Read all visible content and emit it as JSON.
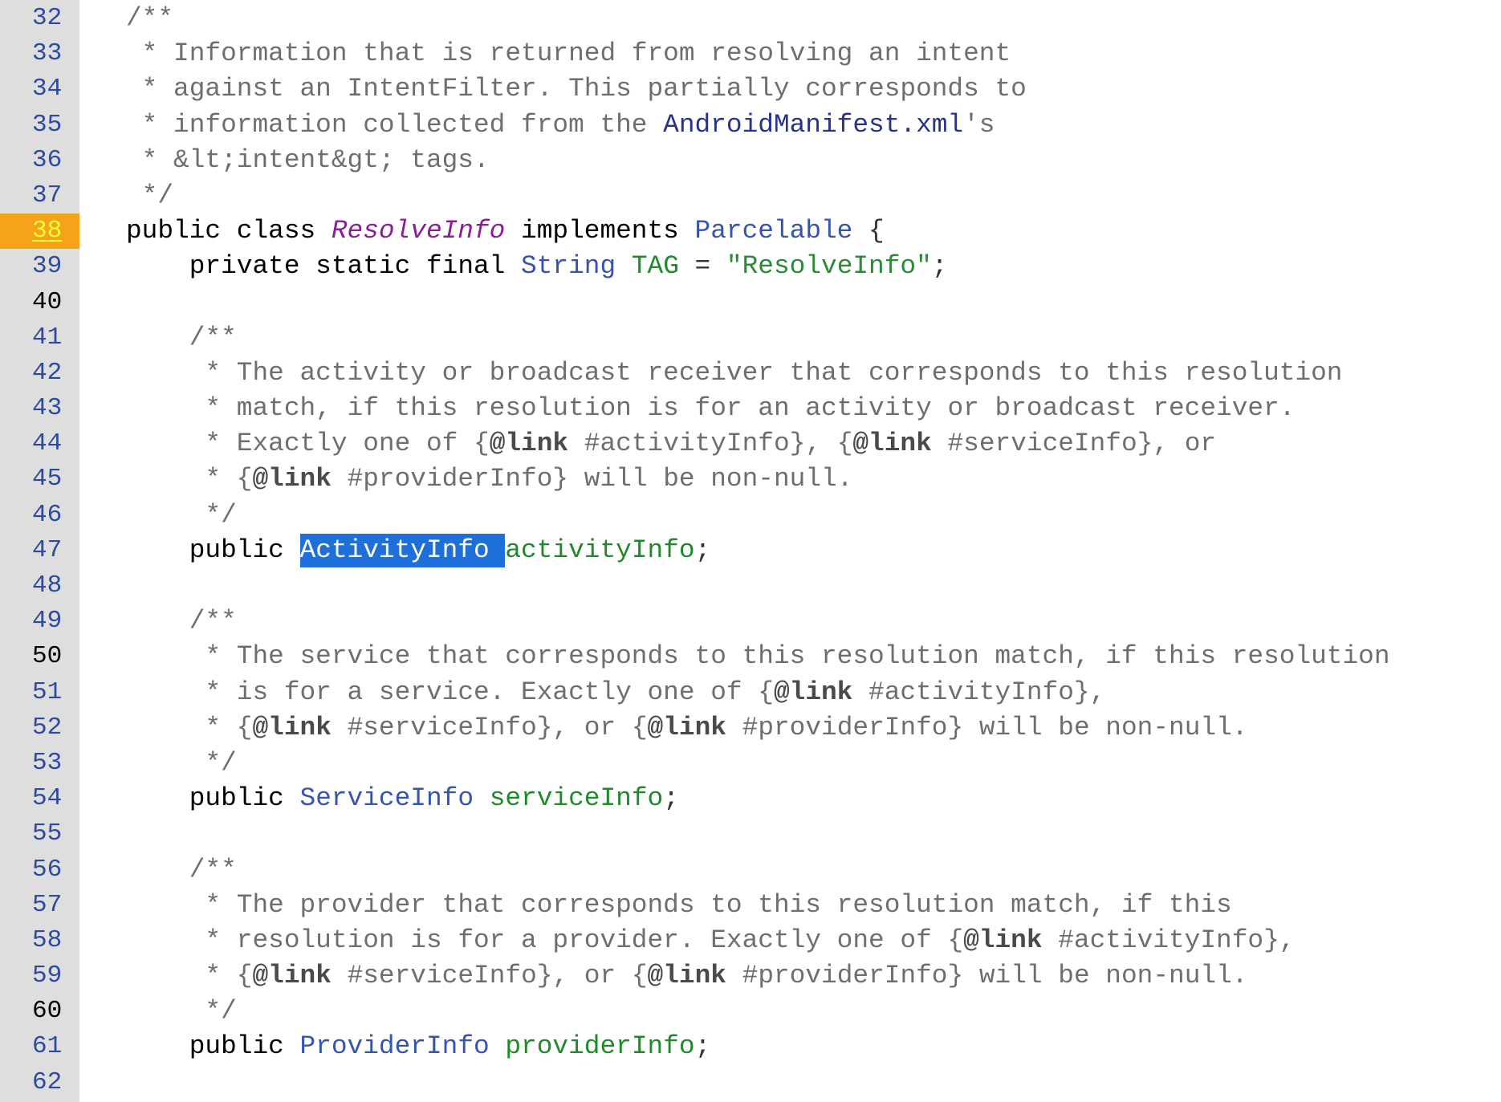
{
  "colors": {
    "editor_bg": "#ffffff",
    "gutter_bg": "#dedede",
    "line_number": "#2c4a9e",
    "line_number_decade": "#000000",
    "current_line_bg": "#f7a21b",
    "current_line_number": "#ffff33",
    "comment": "#6e6e6e",
    "doc_tag": "#4a4a4a",
    "keyword": "#000000",
    "class_decl": "#8b1e95",
    "type": "#3553b0",
    "field": "#1f8a2a",
    "string": "#2a8a36",
    "reference": "#25328f",
    "plain": "#333333",
    "selection_bg": "#1e6fd9",
    "selection_fg": "#ffffff"
  },
  "editor": {
    "lines": [
      {
        "number": 32,
        "tokens": [
          {
            "type": "comment",
            "text": "/**"
          }
        ]
      },
      {
        "number": 33,
        "tokens": [
          {
            "type": "comment",
            "text": " * Information that is returned from resolving an intent"
          }
        ]
      },
      {
        "number": 34,
        "tokens": [
          {
            "type": "comment",
            "text": " * against an IntentFilter. This partially corresponds to"
          }
        ]
      },
      {
        "number": 35,
        "tokens": [
          {
            "type": "comment",
            "text": " * information collected from the "
          },
          {
            "type": "reference",
            "text": "AndroidManifest.xml"
          },
          {
            "type": "comment",
            "text": "'s"
          }
        ]
      },
      {
        "number": 36,
        "tokens": [
          {
            "type": "comment",
            "text": " * &lt;intent&gt; tags."
          }
        ]
      },
      {
        "number": 37,
        "tokens": [
          {
            "type": "comment",
            "text": " */"
          }
        ]
      },
      {
        "number": 38,
        "current": true,
        "tokens": [
          {
            "type": "keyword",
            "text": "public class "
          },
          {
            "type": "class_decl",
            "text": "ResolveInfo"
          },
          {
            "type": "keyword",
            "text": " implements "
          },
          {
            "type": "type",
            "text": "Parcelable"
          },
          {
            "type": "plain",
            "text": " {"
          }
        ]
      },
      {
        "number": 39,
        "tokens": [
          {
            "type": "indent",
            "text": "    "
          },
          {
            "type": "keyword",
            "text": "private static final "
          },
          {
            "type": "type",
            "text": "String"
          },
          {
            "type": "plain",
            "text": " "
          },
          {
            "type": "field",
            "text": "TAG"
          },
          {
            "type": "plain",
            "text": " = "
          },
          {
            "type": "string",
            "text": "\"ResolveInfo\""
          },
          {
            "type": "plain",
            "text": ";"
          }
        ]
      },
      {
        "number": 40,
        "tokens": []
      },
      {
        "number": 41,
        "tokens": [
          {
            "type": "indent",
            "text": "    "
          },
          {
            "type": "comment",
            "text": "/**"
          }
        ]
      },
      {
        "number": 42,
        "tokens": [
          {
            "type": "indent",
            "text": "    "
          },
          {
            "type": "comment",
            "text": " * The activity or broadcast receiver that corresponds to this resolution"
          }
        ]
      },
      {
        "number": 43,
        "tokens": [
          {
            "type": "indent",
            "text": "    "
          },
          {
            "type": "comment",
            "text": " * match, if this resolution is for an activity or broadcast receiver."
          }
        ]
      },
      {
        "number": 44,
        "tokens": [
          {
            "type": "indent",
            "text": "    "
          },
          {
            "type": "comment",
            "text": " * Exactly one of {"
          },
          {
            "type": "doc_tag",
            "text": "@link"
          },
          {
            "type": "comment",
            "text": " #activityInfo}, {"
          },
          {
            "type": "doc_tag",
            "text": "@link"
          },
          {
            "type": "comment",
            "text": " #serviceInfo}, or"
          }
        ]
      },
      {
        "number": 45,
        "tokens": [
          {
            "type": "indent",
            "text": "    "
          },
          {
            "type": "comment",
            "text": " * {"
          },
          {
            "type": "doc_tag",
            "text": "@link"
          },
          {
            "type": "comment",
            "text": " #providerInfo} will be non-null."
          }
        ]
      },
      {
        "number": 46,
        "tokens": [
          {
            "type": "indent",
            "text": "    "
          },
          {
            "type": "comment",
            "text": " */"
          }
        ]
      },
      {
        "number": 47,
        "tokens": [
          {
            "type": "indent",
            "text": "    "
          },
          {
            "type": "keyword",
            "text": "public "
          },
          {
            "type": "selection",
            "text": "ActivityInfo "
          },
          {
            "type": "field",
            "text": "activityInfo"
          },
          {
            "type": "plain",
            "text": ";"
          }
        ]
      },
      {
        "number": 48,
        "tokens": []
      },
      {
        "number": 49,
        "tokens": [
          {
            "type": "indent",
            "text": "    "
          },
          {
            "type": "comment",
            "text": "/**"
          }
        ]
      },
      {
        "number": 50,
        "tokens": [
          {
            "type": "indent",
            "text": "    "
          },
          {
            "type": "comment",
            "text": " * The service that corresponds to this resolution match, if this resolution"
          }
        ]
      },
      {
        "number": 51,
        "tokens": [
          {
            "type": "indent",
            "text": "    "
          },
          {
            "type": "comment",
            "text": " * is for a service. Exactly one of {"
          },
          {
            "type": "doc_tag",
            "text": "@link"
          },
          {
            "type": "comment",
            "text": " #activityInfo},"
          }
        ]
      },
      {
        "number": 52,
        "tokens": [
          {
            "type": "indent",
            "text": "    "
          },
          {
            "type": "comment",
            "text": " * {"
          },
          {
            "type": "doc_tag",
            "text": "@link"
          },
          {
            "type": "comment",
            "text": " #serviceInfo}, or {"
          },
          {
            "type": "doc_tag",
            "text": "@link"
          },
          {
            "type": "comment",
            "text": " #providerInfo} will be non-null."
          }
        ]
      },
      {
        "number": 53,
        "tokens": [
          {
            "type": "indent",
            "text": "    "
          },
          {
            "type": "comment",
            "text": " */"
          }
        ]
      },
      {
        "number": 54,
        "tokens": [
          {
            "type": "indent",
            "text": "    "
          },
          {
            "type": "keyword",
            "text": "public "
          },
          {
            "type": "type",
            "text": "ServiceInfo"
          },
          {
            "type": "plain",
            "text": " "
          },
          {
            "type": "field",
            "text": "serviceInfo"
          },
          {
            "type": "plain",
            "text": ";"
          }
        ]
      },
      {
        "number": 55,
        "tokens": []
      },
      {
        "number": 56,
        "tokens": [
          {
            "type": "indent",
            "text": "    "
          },
          {
            "type": "comment",
            "text": "/**"
          }
        ]
      },
      {
        "number": 57,
        "tokens": [
          {
            "type": "indent",
            "text": "    "
          },
          {
            "type": "comment",
            "text": " * The provider that corresponds to this resolution match, if this"
          }
        ]
      },
      {
        "number": 58,
        "tokens": [
          {
            "type": "indent",
            "text": "    "
          },
          {
            "type": "comment",
            "text": " * resolution is for a provider. Exactly one of {"
          },
          {
            "type": "doc_tag",
            "text": "@link"
          },
          {
            "type": "comment",
            "text": " #activityInfo},"
          }
        ]
      },
      {
        "number": 59,
        "tokens": [
          {
            "type": "indent",
            "text": "    "
          },
          {
            "type": "comment",
            "text": " * {"
          },
          {
            "type": "doc_tag",
            "text": "@link"
          },
          {
            "type": "comment",
            "text": " #serviceInfo}, or {"
          },
          {
            "type": "doc_tag",
            "text": "@link"
          },
          {
            "type": "comment",
            "text": " #providerInfo} will be non-null."
          }
        ]
      },
      {
        "number": 60,
        "tokens": [
          {
            "type": "indent",
            "text": "    "
          },
          {
            "type": "comment",
            "text": " */"
          }
        ]
      },
      {
        "number": 61,
        "tokens": [
          {
            "type": "indent",
            "text": "    "
          },
          {
            "type": "keyword",
            "text": "public "
          },
          {
            "type": "type",
            "text": "ProviderInfo"
          },
          {
            "type": "plain",
            "text": " "
          },
          {
            "type": "field",
            "text": "providerInfo"
          },
          {
            "type": "plain",
            "text": ";"
          }
        ]
      },
      {
        "number": 62,
        "tokens": []
      }
    ]
  }
}
